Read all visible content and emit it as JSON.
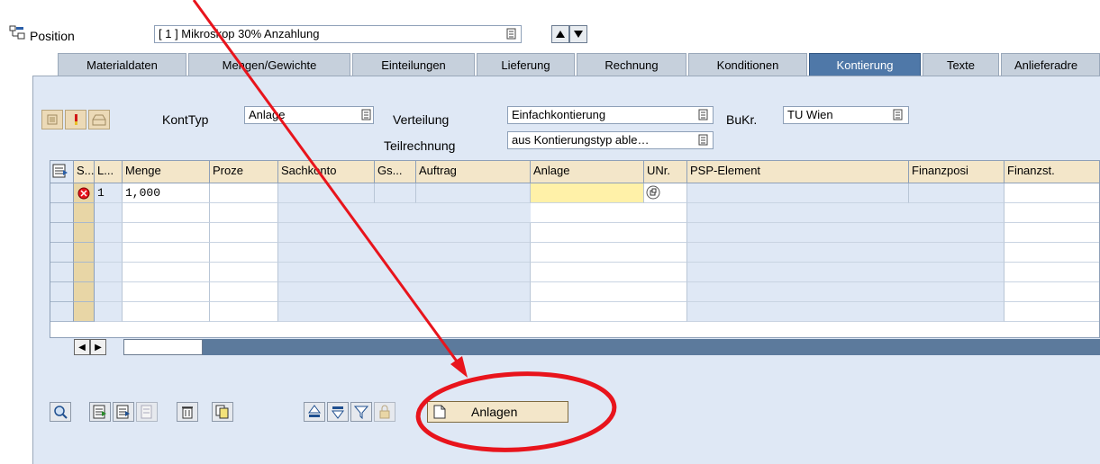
{
  "header": {
    "position_label": "Position",
    "position_value": "[ 1 ] Mikroskop 30% Anzahlung"
  },
  "tabs": [
    {
      "label": "Materialdaten",
      "active": false
    },
    {
      "label": "Mengen/Gewichte",
      "active": false
    },
    {
      "label": "Einteilungen",
      "active": false
    },
    {
      "label": "Lieferung",
      "active": false
    },
    {
      "label": "Rechnung",
      "active": false
    },
    {
      "label": "Konditionen",
      "active": false
    },
    {
      "label": "Kontierung",
      "active": true
    },
    {
      "label": "Texte",
      "active": false
    },
    {
      "label": "Anlieferadre",
      "active": false
    }
  ],
  "form": {
    "konttyp_label": "KontTyp",
    "konttyp_value": "Anlage",
    "verteilung_label": "Verteilung",
    "verteilung_value": "Einfachkontierung",
    "bukr_label": "BuKr.",
    "bukr_value": "TU Wien",
    "teilrechnung_label": "Teilrechnung",
    "teilrechnung_value": "aus Kontierungstyp able…"
  },
  "grid": {
    "columns": [
      "S...",
      "L...",
      "Menge",
      "Proze",
      "Sachkonto",
      "Gs...",
      "Auftrag",
      "Anlage",
      "UNr.",
      "PSP-Element",
      "Finanzposi",
      "Finanzst."
    ],
    "rows": [
      {
        "line": "1",
        "menge": "1,000"
      }
    ]
  },
  "buttons": {
    "anlagen_label": "Anlagen"
  },
  "colors": {
    "tab_active": "#4f78a8",
    "panel_bg": "#dfe8f5",
    "annotation": "#e8141c"
  }
}
